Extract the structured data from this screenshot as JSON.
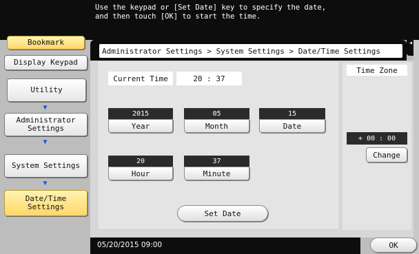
{
  "message": "Use the keypad or [Set Date] key to specify the date,\nand then touch [OK] to start the time.",
  "sidebar": {
    "bookmark": "Bookmark",
    "display_keypad": "Display Keypad",
    "path": [
      {
        "label": "Utility"
      },
      {
        "label": "Administrator\nSettings"
      },
      {
        "label": "System Settings"
      },
      {
        "label": "Date/Time\nSettings"
      }
    ]
  },
  "collapse_icon": "◂◂",
  "breadcrumb": "Administrator Settings > System Settings > Date/Time Settings",
  "current_time": {
    "label": "Current Time",
    "value": "20 : 37"
  },
  "fields": {
    "year": {
      "value": "2015",
      "label": "Year"
    },
    "month": {
      "value": "05",
      "label": "Month"
    },
    "date": {
      "value": "15",
      "label": "Date"
    },
    "hour": {
      "value": "20",
      "label": "Hour"
    },
    "minute": {
      "value": "37",
      "label": "Minute"
    }
  },
  "set_date_label": "Set Date",
  "time_zone": {
    "title": "Time Zone",
    "value": "+ 00 : 00",
    "change_label": "Change"
  },
  "status_datetime": "05/20/2015  09:00",
  "ok_label": "OK",
  "colors": {
    "accent_yellow": "#ffd76a",
    "arrow_blue": "#1f56d8",
    "bar_black": "#0d0d0d"
  },
  "icons": {
    "arrow": "arrow-down-icon"
  }
}
